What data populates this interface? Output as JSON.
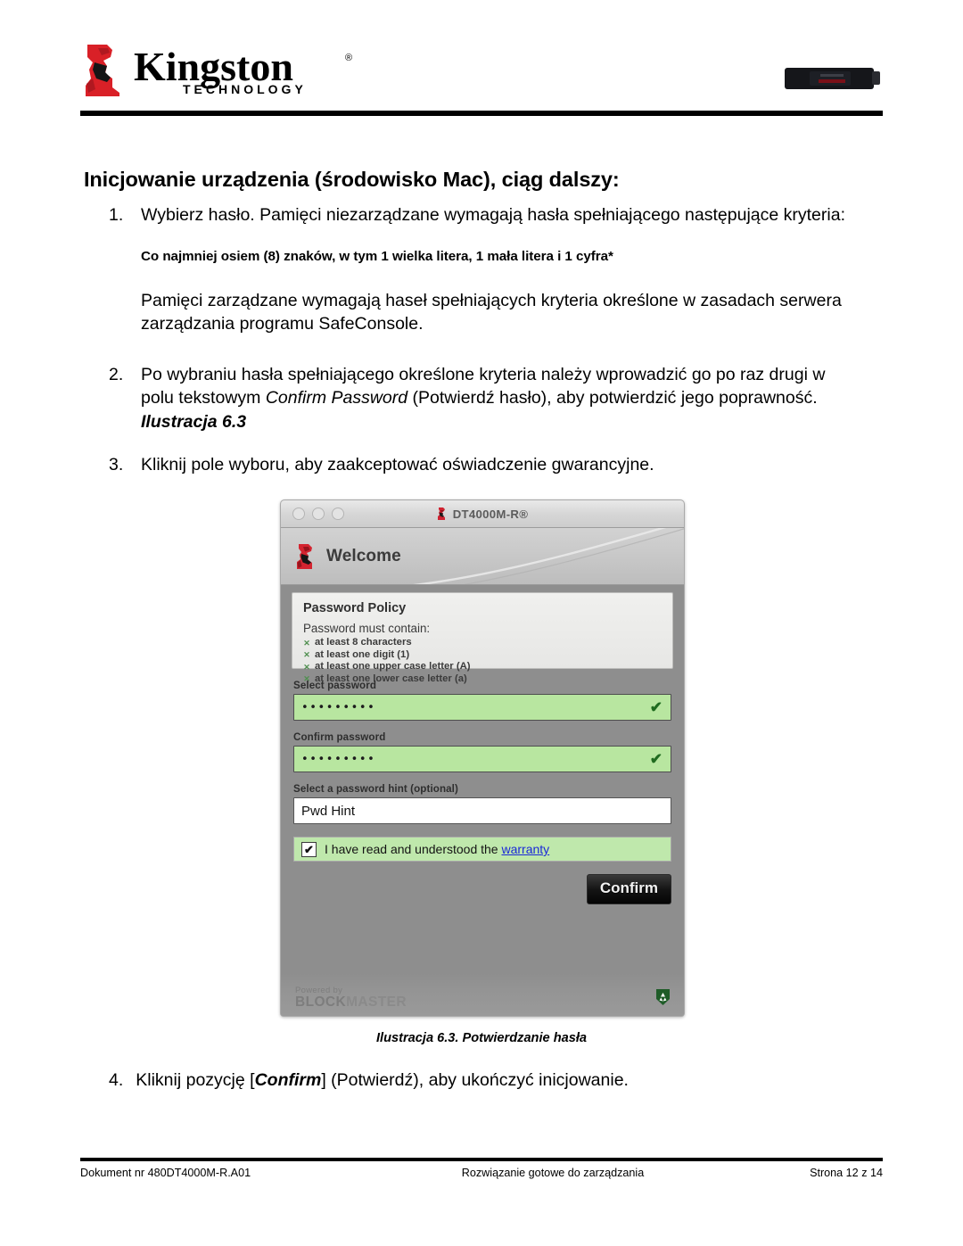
{
  "header": {
    "logo_brand": "Kingston",
    "logo_sub": "T E C H N O L O G Y",
    "logo_icon": "kingston-sphinx-icon",
    "product_image_label": "DataTraveler USB drive photo"
  },
  "title": "Inicjowanie urządzenia (środowisko Mac), ciąg dalszy:",
  "steps": [
    {
      "num": "1.",
      "text": "Wybierz hasło. Pamięci niezarządzane wymagają hasła spełniającego następujące kryteria:"
    },
    {
      "num": "2.",
      "text_pre": "Po wybraniu hasła spełniającego określone kryteria należy wprowadzić go po raz drugi w polu tekstowym ",
      "italic_term": "Confirm Password",
      "text_mid": " (Potwierdź hasło), aby potwierdzić jego poprawność. ",
      "bold_italic_ref": "Ilustracja 6.3"
    },
    {
      "num": "3.",
      "text": "Kliknij pole wyboru, aby zaakceptować oświadczenie gwarancyjne."
    },
    {
      "num": "4.",
      "text_pre": "Kliknij pozycję [",
      "bold_term": "Confirm",
      "text_post": "] (Potwierdź), aby ukończyć inicjowanie."
    }
  ],
  "criteria_line": "Co najmniej osiem (8) znaków, w tym 1 wielka litera, 1 mała litera i 1 cyfra*",
  "managed_note": "Pamięci zarządzane wymagają haseł spełniających kryteria określone w zasadach serwera zarządzania programu SafeConsole.",
  "figure": {
    "caption": "Ilustracja 6.3. Potwierdzanie hasła",
    "window": {
      "title": "DT4000M-R®",
      "title_icon": "kingston-sphinx-icon",
      "traffic_lights": [
        "close-light",
        "minimize-light",
        "zoom-light"
      ],
      "welcome_heading": "Welcome",
      "welcome_icon": "kingston-sphinx-icon",
      "policy": {
        "heading": "Password Policy",
        "subheading": "Password must contain:",
        "requirements": [
          "at least 8 characters",
          "at least one digit (1)",
          "at least one upper case letter (A)",
          "at least one lower case letter (a)"
        ],
        "marker_color": "#4f8f4f"
      },
      "select_password": {
        "label": "Select password",
        "value": "•••••••••",
        "valid_mark": "✔",
        "field_color": "#b8e6a0"
      },
      "confirm_password": {
        "label": "Confirm password",
        "value": "•••••••••",
        "valid_mark": "✔",
        "field_color": "#b8e6a0"
      },
      "password_hint": {
        "label": "Select a password hint (optional)",
        "value": "Pwd Hint",
        "field_color": "#ffffff"
      },
      "warranty": {
        "checkbox_mark": "✔",
        "text": "I have read and understood the ",
        "link": "warranty",
        "link_color": "#1a28d8",
        "row_color": "#bfe8ac"
      },
      "confirm_button": "Confirm",
      "powered_by": {
        "small": "Powered by",
        "brand_a": "BLOCK",
        "brand_b": "MASTER",
        "shield_icon": "blockmaster-shield-icon"
      }
    }
  },
  "footer": {
    "document_no": "Dokument nr 480DT4000M-R.A01",
    "center": "Rozwiązanie gotowe do zarządzania",
    "page": "Strona 12 z 14"
  }
}
